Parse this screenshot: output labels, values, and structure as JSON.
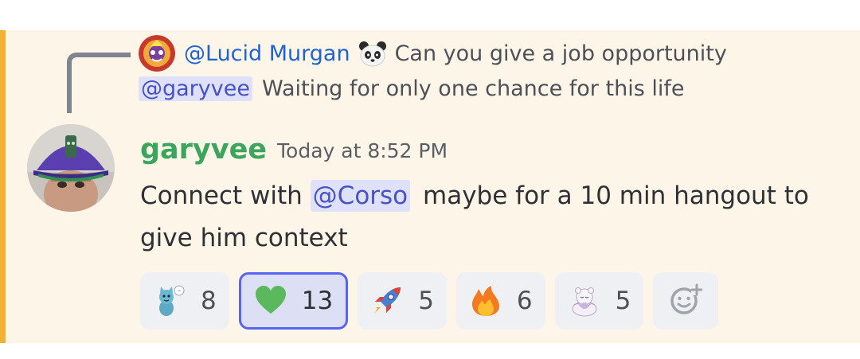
{
  "reply": {
    "author": "@Lucid Murgan",
    "text_line1": "Can you give a job opportunity",
    "mention": "@garyvee",
    "text_line2": "Waiting for only one chance for this life",
    "author_icon": "panda-icon"
  },
  "message": {
    "author": "garyvee",
    "timestamp": "Today at 8:52 PM",
    "content_prefix": "Connect with",
    "mention": "@Corso",
    "content_suffix": "maybe for a 10 min hangout to give him context"
  },
  "reactions": [
    {
      "emoji": "cat-sticker-icon",
      "count": "8",
      "active": false
    },
    {
      "emoji": "green-heart-icon",
      "count": "13",
      "active": true
    },
    {
      "emoji": "rocket-icon",
      "count": "5",
      "active": false
    },
    {
      "emoji": "fire-icon",
      "count": "6",
      "active": false
    },
    {
      "emoji": "meditating-bear-icon",
      "count": "5",
      "active": false
    }
  ],
  "add_reaction_icon": "add-reaction-icon",
  "colors": {
    "mention_highlight": "#fdf5e8",
    "mention_bar": "#f0b232",
    "author": "#3ba55d",
    "mention_bg": "#dfe1fb",
    "mention_text": "#4752c4",
    "active_reaction_border": "#5865f2"
  }
}
